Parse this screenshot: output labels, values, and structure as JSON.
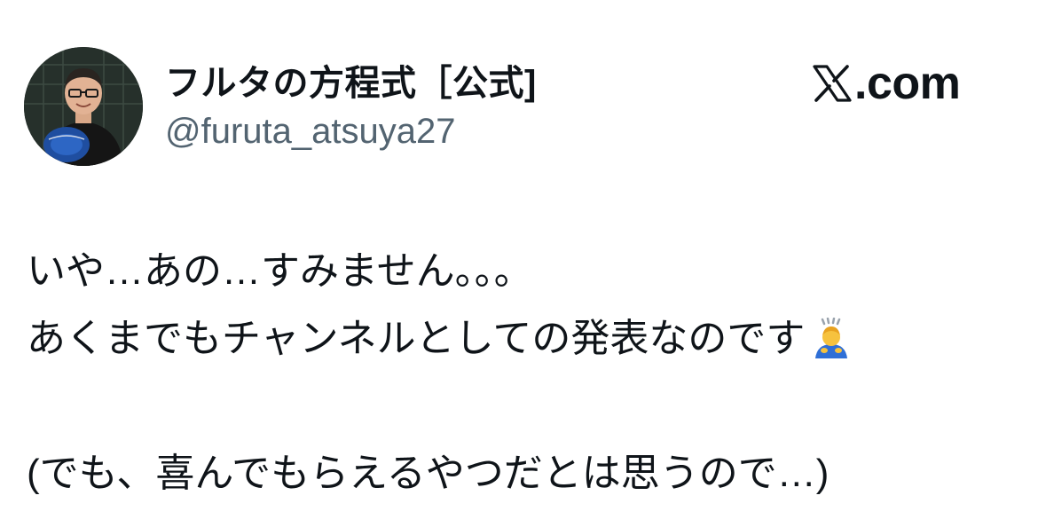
{
  "tweet": {
    "author": {
      "display_name": "フルタの方程式［公式]",
      "handle": "@furuta_atsuya27"
    },
    "brand": {
      "logo_icon": "x-logo-icon",
      "text": ".com"
    },
    "body": {
      "line1": "いや…あの…すみません。。。",
      "line2": "あくまでもチャンネルとしての発表なのです",
      "line2_emoji": "bowing-person-emoji",
      "line3": "(でも、喜んでもらえるやつだとは思うので…)"
    }
  }
}
